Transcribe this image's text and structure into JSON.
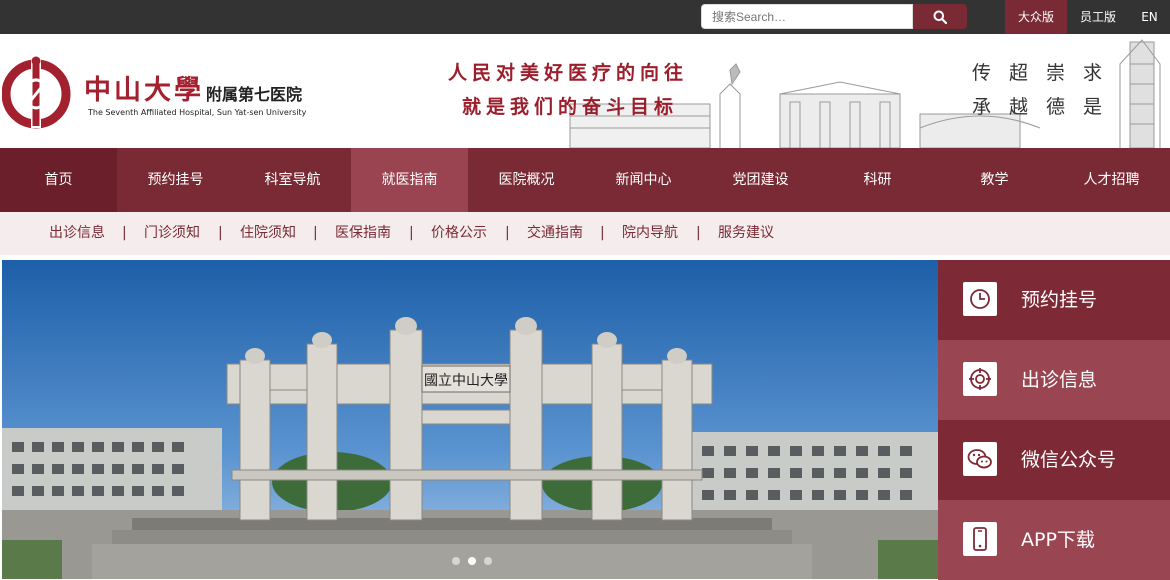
{
  "topbar": {
    "search_placeholder": "搜索Search…",
    "versions": [
      "大众版",
      "员工版",
      "EN"
    ]
  },
  "header": {
    "cn_name": "中山大學",
    "cn_name2": "附属第七医院",
    "en_name": "The Seventh Affiliated Hospital, Sun Yat-sen University",
    "slogan_line1": "人民对美好医疗的向往",
    "slogan_line2": "就是我们的奋斗目标",
    "motto_line1": "传超崇求",
    "motto_line2": "承越德是"
  },
  "main_nav": [
    "首页",
    "预约挂号",
    "科室导航",
    "就医指南",
    "医院概况",
    "新闻中心",
    "党团建设",
    "科研",
    "教学",
    "人才招聘"
  ],
  "sub_nav": [
    "出诊信息",
    "门诊须知",
    "住院须知",
    "医保指南",
    "价格公示",
    "交通指南",
    "院内导航",
    "服务建议"
  ],
  "sub_nav_separator": "|",
  "banner": {
    "arch_plaque": "國立中山大學",
    "slide_count": 3,
    "active_slide": 2
  },
  "quick_links": [
    {
      "label": "预约挂号",
      "icon": "clock-icon"
    },
    {
      "label": "出诊信息",
      "icon": "target-icon"
    },
    {
      "label": "微信公众号",
      "icon": "wechat-icon"
    },
    {
      "label": "APP下载",
      "icon": "phone-icon"
    }
  ],
  "colors": {
    "brand": "#7a2a34",
    "topbar": "#333333",
    "logo_red": "#a3212e"
  }
}
